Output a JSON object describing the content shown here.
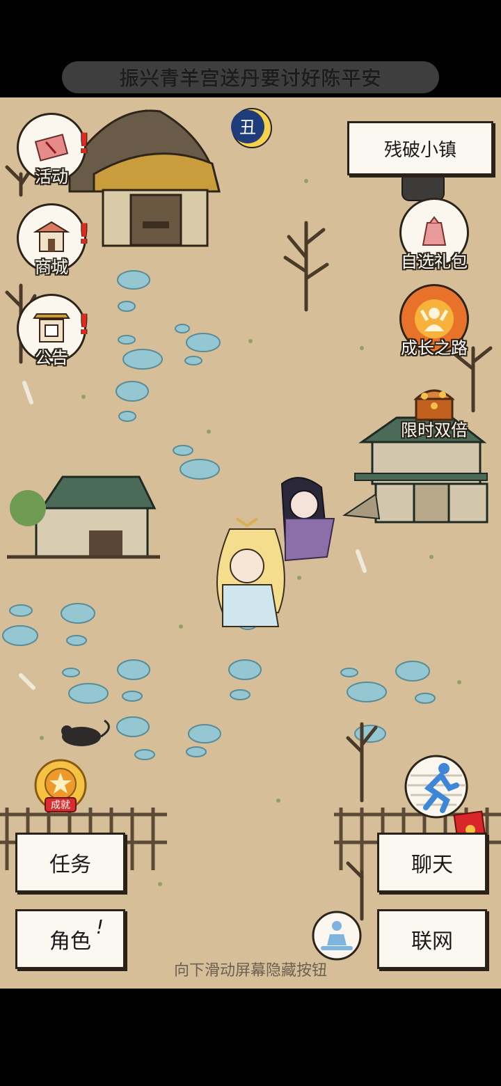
{
  "quest_banner": {
    "text": "振兴青羊宫送丹要讨好陈平安"
  },
  "location": {
    "name": "残破小镇"
  },
  "time_icon": {
    "glyph": "丑",
    "icon": "moon-clock-icon"
  },
  "left_buttons": [
    {
      "label": "活动",
      "icon": "scroll-icon",
      "alert": "!"
    },
    {
      "label": "商城",
      "icon": "shop-icon",
      "alert": "!"
    },
    {
      "label": "公告",
      "icon": "notice-board-icon",
      "alert": "!"
    }
  ],
  "right_buttons": [
    {
      "label": "自选礼包",
      "icon": "gift-bag-icon"
    },
    {
      "label": "成长之路",
      "icon": "growth-icon"
    },
    {
      "label": "限时双倍",
      "icon": "treasure-chest-icon"
    }
  ],
  "achievement": {
    "badge_text": "成就",
    "icon": "achievement-medal-icon"
  },
  "bottom_buttons": {
    "task": "任务",
    "chat": "聊天",
    "role": "角色",
    "role_alert": "!",
    "network": "联网"
  },
  "run_icon": "running-man-icon",
  "meditate_icon": "meditation-icon",
  "red_packet_icon": "red-envelope-icon",
  "swipe_hint": "向下滑动屏幕隐藏按钮",
  "colors": {
    "ground": "#d6bf98",
    "stone": "#8fc4cf",
    "alert": "#e02a1d",
    "roof_green": "#4b6b58"
  }
}
